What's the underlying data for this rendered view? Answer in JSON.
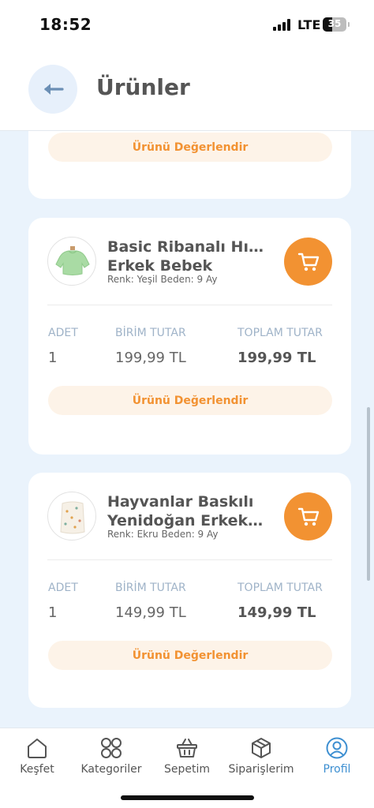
{
  "status_bar": {
    "time": "18:52",
    "network": "LTE",
    "battery": "35"
  },
  "header": {
    "title": "Ürünler",
    "back_icon": "arrow-left-icon"
  },
  "top_card": {
    "review_label": "Ürünü Değerlendir"
  },
  "products": [
    {
      "name_line1": "Basic Ribanalı Hırka",
      "name_line2": "Erkek Bebek",
      "variant": "Renk: Yeşil  Beden: 9 Ay",
      "qty_label": "ADET",
      "qty": "1",
      "unit_label": "BİRİM TUTAR",
      "unit_price": "199,99 TL",
      "total_label": "TOPLAM TUTAR",
      "total_price": "199,99 TL",
      "review_label": "Ürünü Değerlendir",
      "thumb_color": "#a9dba4"
    },
    {
      "name_line1": "Hayvanlar Baskılı",
      "name_line2": "Yenidoğan Erkek Bo...",
      "variant": "Renk: Ekru  Beden: 9 Ay",
      "qty_label": "ADET",
      "qty": "1",
      "unit_label": "BİRİM TUTAR",
      "unit_price": "149,99 TL",
      "total_label": "TOPLAM TUTAR",
      "total_price": "149,99 TL",
      "review_label": "Ürünü Değerlendir",
      "thumb_color": "#f3ece0"
    }
  ],
  "tabbar": {
    "items": [
      {
        "label": "Keşfet",
        "icon": "home-icon"
      },
      {
        "label": "Kategoriler",
        "icon": "grid-icon"
      },
      {
        "label": "Sepetim",
        "icon": "basket-icon"
      },
      {
        "label": "Siparişlerim",
        "icon": "package-icon"
      },
      {
        "label": "Profil",
        "icon": "user-icon",
        "active": true
      }
    ]
  },
  "colors": {
    "accent": "#f29232",
    "active": "#3d8fd1",
    "background": "#eaf3fc"
  }
}
